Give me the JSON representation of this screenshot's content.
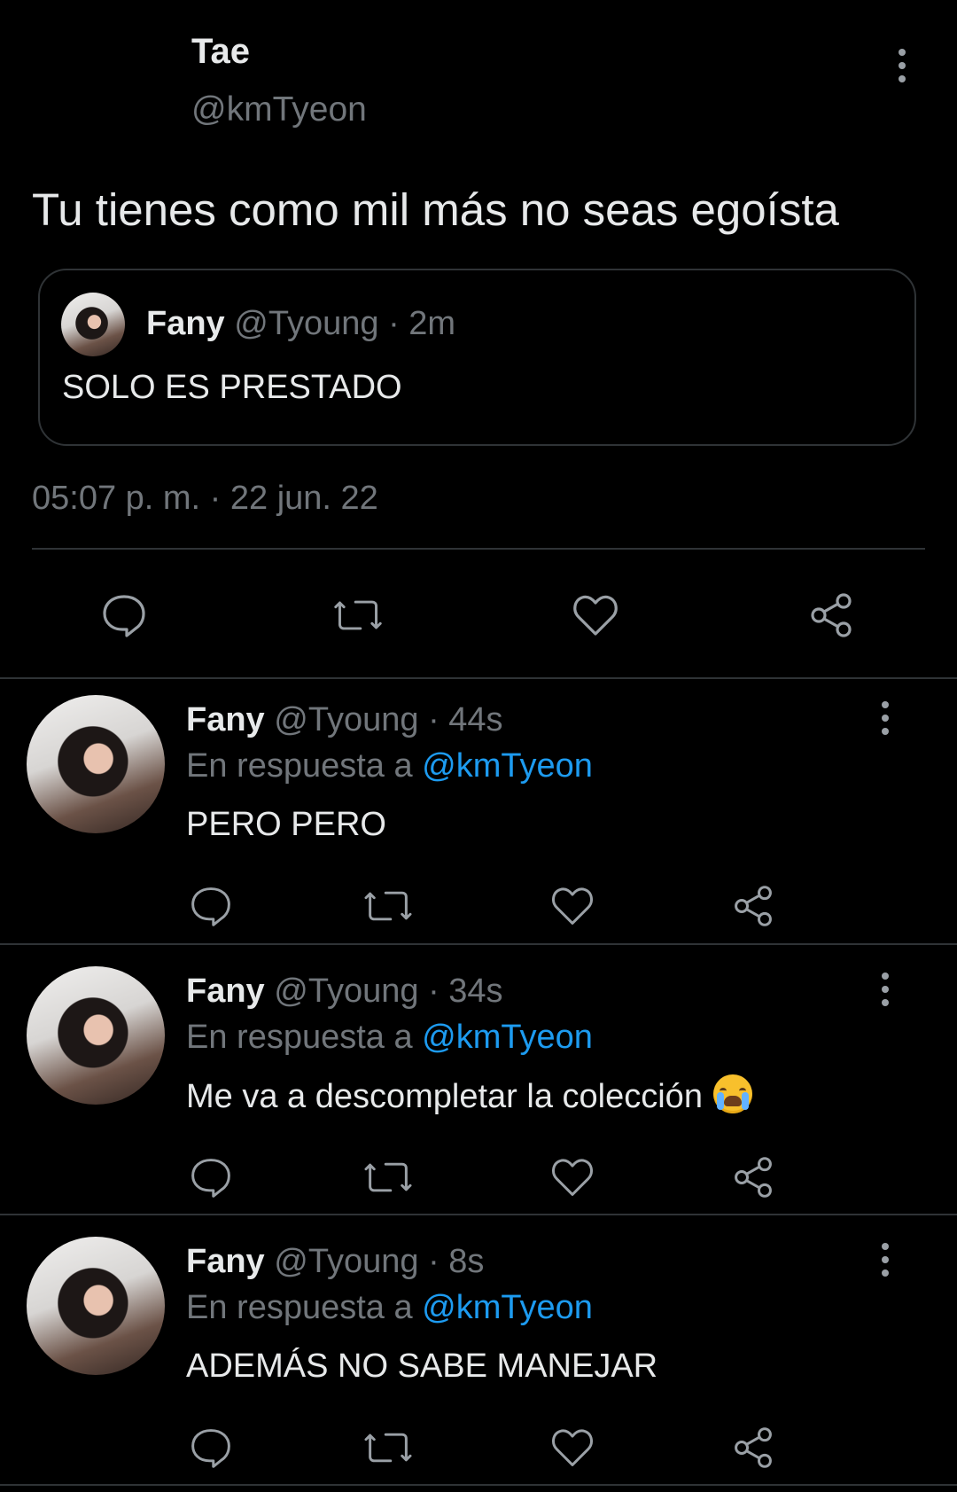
{
  "main_tweet": {
    "author_name": "Tae",
    "author_handle": "@kmTyeon",
    "text": "Tu tienes como mil más no seas egoísta",
    "timestamp": "05:07 p. m. · 22 jun. 22",
    "quoted_tweet": {
      "author_name": "Fany",
      "author_handle": "@Tyoung",
      "time_ago": "· 2m",
      "text": "SOLO ES PRESTADO"
    }
  },
  "replies": [
    {
      "author_name": "Fany",
      "author_handle": "@Tyoung",
      "time_ago": "· 44s",
      "replying_prefix": "En respuesta a",
      "replying_to": "@kmTyeon",
      "text": "PERO PERO"
    },
    {
      "author_name": "Fany",
      "author_handle": "@Tyoung",
      "time_ago": "· 34s",
      "replying_prefix": "En respuesta a",
      "replying_to": "@kmTyeon",
      "text": "Me va a descompletar la colección"
    },
    {
      "author_name": "Fany",
      "author_handle": "@Tyoung",
      "time_ago": "· 8s",
      "replying_prefix": "En respuesta a",
      "replying_to": "@kmTyeon",
      "text": "ADEMÁS NO SABE MANEJAR"
    }
  ],
  "icons": {
    "more": "more-options-icon",
    "reply": "reply-icon",
    "retweet": "retweet-icon",
    "like": "like-icon",
    "share": "share-icon",
    "crying_emoji": "crying-face-emoji"
  },
  "colors": {
    "background": "#000000",
    "text": "#e7e9ea",
    "muted": "#71767b",
    "link": "#1d9bf0",
    "divider": "#2f3336"
  }
}
